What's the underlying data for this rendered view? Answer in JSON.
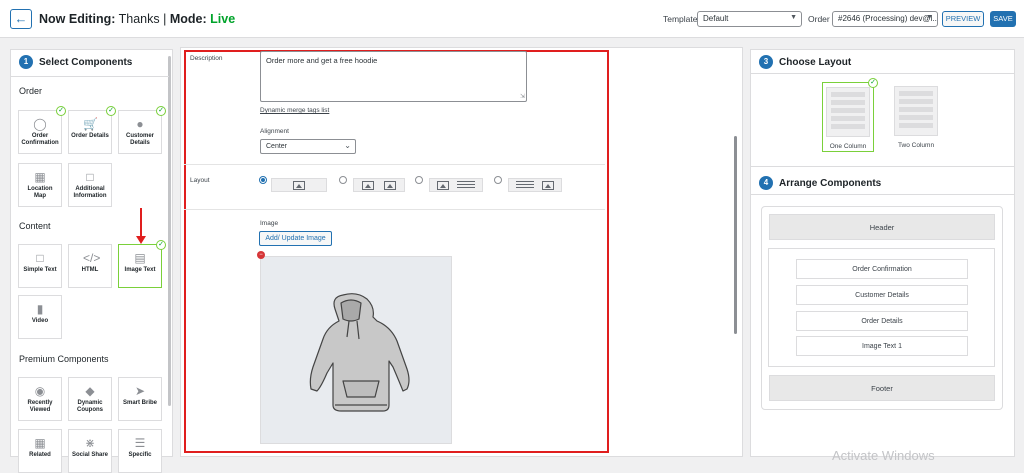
{
  "header": {
    "back_icon": "arrow-left-icon",
    "title_prefix": "Now Editing:",
    "title_name": "Thanks",
    "title_sep": "|",
    "mode_label": "Mode:",
    "mode_value": "Live",
    "template_label": "Template",
    "template_value": "Default",
    "order_label": "Order",
    "order_value": "#2646 (Processing) dev@l...",
    "preview_label": "PREVIEW",
    "save_label": "SAVE"
  },
  "left": {
    "step_num": "1",
    "step_title": "Select Components",
    "order_title": "Order",
    "order_items": [
      {
        "label": "Order Confirmation",
        "icon": "check-circle-icon",
        "checked": true
      },
      {
        "label": "Order Details",
        "icon": "cart-icon",
        "checked": true
      },
      {
        "label": "Customer Details",
        "icon": "user-icon",
        "checked": true
      },
      {
        "label": "Location Map",
        "icon": "map-icon",
        "checked": false
      },
      {
        "label": "Additional Information",
        "icon": "note-icon",
        "checked": false
      }
    ],
    "content_title": "Content",
    "content_items": [
      {
        "label": "Simple Text",
        "icon": "note-icon",
        "checked": false
      },
      {
        "label": "HTML",
        "icon": "code-icon",
        "checked": false
      },
      {
        "label": "Image Text",
        "icon": "image-text-icon",
        "checked": true
      },
      {
        "label": "Video",
        "icon": "video-icon",
        "checked": false
      }
    ],
    "premium_title": "Premium Components",
    "premium_items": [
      {
        "label": "Recently Viewed",
        "icon": "eye-icon"
      },
      {
        "label": "Dynamic Coupons",
        "icon": "tag-icon"
      },
      {
        "label": "Smart Bribe",
        "icon": "rocket-icon"
      },
      {
        "label": "Related",
        "icon": "grid-icon"
      },
      {
        "label": "Social Share",
        "icon": "share-icon"
      },
      {
        "label": "Specific",
        "icon": "list-icon"
      }
    ]
  },
  "center": {
    "description_label": "Description",
    "description_value": "Order more and get a free hoodie",
    "merge_tags_link": "Dynamic merge tags list",
    "alignment_label": "Alignment",
    "alignment_value": "Center",
    "layout_label": "Layout",
    "image_label": "Image",
    "update_image_label": "Add/ Update Image",
    "selected_layout": 0
  },
  "right": {
    "choose_num": "3",
    "choose_title": "Choose Layout",
    "layouts": [
      {
        "label": "One Column",
        "selected": true
      },
      {
        "label": "Two Column",
        "selected": false
      }
    ],
    "arrange_num": "4",
    "arrange_title": "Arrange Components",
    "header_label": "Header",
    "items": [
      "Order Confirmation",
      "Customer Details",
      "Order Details",
      "Image Text 1"
    ],
    "footer_label": "Footer",
    "watermark": "Activate Windows"
  },
  "colors": {
    "accent": "#2271b1",
    "live": "#00a32a",
    "highlight": "#e01e1e",
    "check": "#7ad03a"
  }
}
